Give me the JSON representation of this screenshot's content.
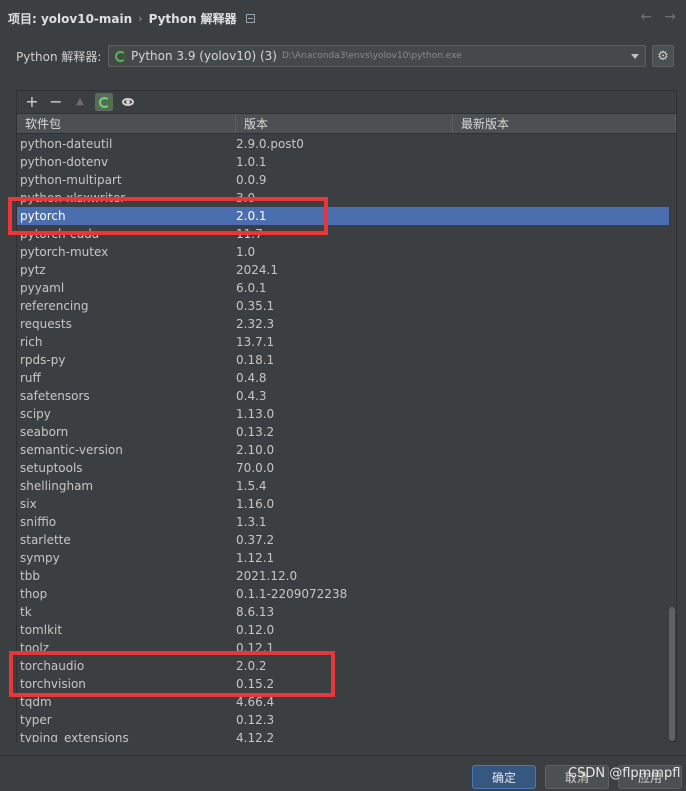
{
  "breadcrumb": {
    "project": "项目: yolov10-main",
    "separator": "›",
    "page": "Python 解释器"
  },
  "nav": {
    "back": "←",
    "forward": "→"
  },
  "interpreter": {
    "label": "Python 解释器:",
    "name": "Python 3.9 (yolov10) (3)",
    "path": "D:\\Anaconda3\\envs\\yolov10\\python.exe",
    "settings_icon": "gear-icon"
  },
  "toolbar": {
    "add": "+",
    "remove": "−",
    "up": "▲"
  },
  "table": {
    "headers": [
      "软件包",
      "版本",
      "最新版本"
    ],
    "top_partial": "python-dateutil",
    "rows": [
      {
        "name": "python-dateutil",
        "version": "2.9.0.post0",
        "latest": ""
      },
      {
        "name": "python-dotenv",
        "version": "1.0.1",
        "latest": ""
      },
      {
        "name": "python-multipart",
        "version": "0.0.9",
        "latest": ""
      },
      {
        "name": "python-xlsxwriter",
        "version": "3.0",
        "latest": ""
      },
      {
        "name": "pytorch",
        "version": "2.0.1",
        "latest": ""
      },
      {
        "name": "pytorch-cuda",
        "version": "11.7",
        "latest": ""
      },
      {
        "name": "pytorch-mutex",
        "version": "1.0",
        "latest": ""
      },
      {
        "name": "pytz",
        "version": "2024.1",
        "latest": ""
      },
      {
        "name": "pyyaml",
        "version": "6.0.1",
        "latest": ""
      },
      {
        "name": "referencing",
        "version": "0.35.1",
        "latest": ""
      },
      {
        "name": "requests",
        "version": "2.32.3",
        "latest": ""
      },
      {
        "name": "rich",
        "version": "13.7.1",
        "latest": ""
      },
      {
        "name": "rpds-py",
        "version": "0.18.1",
        "latest": ""
      },
      {
        "name": "ruff",
        "version": "0.4.8",
        "latest": ""
      },
      {
        "name": "safetensors",
        "version": "0.4.3",
        "latest": ""
      },
      {
        "name": "scipy",
        "version": "1.13.0",
        "latest": ""
      },
      {
        "name": "seaborn",
        "version": "0.13.2",
        "latest": ""
      },
      {
        "name": "semantic-version",
        "version": "2.10.0",
        "latest": ""
      },
      {
        "name": "setuptools",
        "version": "70.0.0",
        "latest": ""
      },
      {
        "name": "shellingham",
        "version": "1.5.4",
        "latest": ""
      },
      {
        "name": "six",
        "version": "1.16.0",
        "latest": ""
      },
      {
        "name": "sniffio",
        "version": "1.3.1",
        "latest": ""
      },
      {
        "name": "starlette",
        "version": "0.37.2",
        "latest": ""
      },
      {
        "name": "sympy",
        "version": "1.12.1",
        "latest": ""
      },
      {
        "name": "tbb",
        "version": "2021.12.0",
        "latest": ""
      },
      {
        "name": "thop",
        "version": "0.1.1-2209072238",
        "latest": ""
      },
      {
        "name": "tk",
        "version": "8.6.13",
        "latest": ""
      },
      {
        "name": "tomlkit",
        "version": "0.12.0",
        "latest": ""
      },
      {
        "name": "toolz",
        "version": "0.12.1",
        "latest": ""
      },
      {
        "name": "torchaudio",
        "version": "2.0.2",
        "latest": ""
      },
      {
        "name": "torchvision",
        "version": "0.15.2",
        "latest": ""
      },
      {
        "name": "tqdm",
        "version": "4.66.4",
        "latest": ""
      },
      {
        "name": "typer",
        "version": "0.12.3",
        "latest": ""
      },
      {
        "name": "typing_extensions",
        "version": "4.12.2",
        "latest": ""
      }
    ],
    "selected_row": "pytorch"
  },
  "footer": {
    "ok": "确定",
    "cancel": "取消",
    "apply": "应用"
  },
  "watermark": "CSDN @flpmmpfl",
  "colors": {
    "selection": "#4b6eaf",
    "highlight_box": "#e8363a",
    "primary_button": "#365880"
  }
}
